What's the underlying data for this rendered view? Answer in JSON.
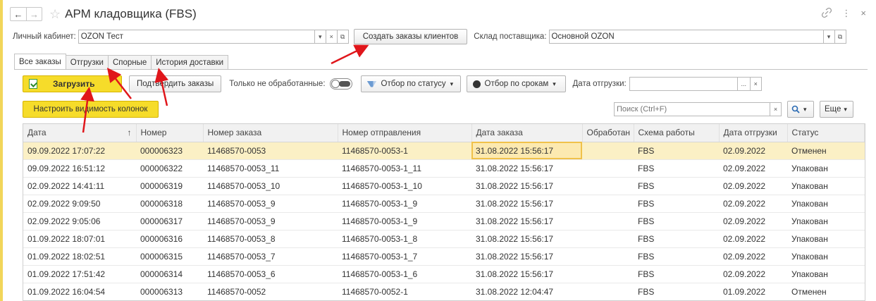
{
  "window": {
    "title": "АРМ кладовщика (FBS)",
    "back_icon": "←",
    "forward_icon": "→",
    "link_icon": "🔗",
    "menu_icon": "⋮",
    "close_icon": "×"
  },
  "header": {
    "cabinet_label": "Личный кабинет:",
    "cabinet_value": "OZON Тест",
    "create_orders_label": "Создать заказы клиентов",
    "warehouse_label": "Склад поставщика:",
    "warehouse_value": "Основной OZON"
  },
  "tabs": [
    {
      "label": "Все заказы",
      "active": true
    },
    {
      "label": "Отгрузки",
      "active": false
    },
    {
      "label": "Спорные",
      "active": false
    },
    {
      "label": "История доставки",
      "active": false
    }
  ],
  "toolbar": {
    "load_label": "Загрузить",
    "confirm_label": "Подтвердить заказы",
    "only_unprocessed_label": "Только не обработанные:",
    "status_filter_label": "Отбор по статусу",
    "term_filter_label": "Отбор по срокам",
    "ship_date_label": "Дата отгрузки:",
    "ship_date_value": "",
    "ellipsis": "...",
    "clear": "×",
    "columns_label": "Настроить видимость колонок",
    "search_placeholder": "Поиск (Ctrl+F)",
    "more_label": "Еще",
    "sort_arrow": "↑",
    "dropdown_arrow": "▾"
  },
  "table": {
    "columns": [
      "Дата",
      "Номер",
      "Номер заказа",
      "Номер отправления",
      "Дата заказа",
      "Обработан",
      "Схема работы",
      "Дата отгрузки",
      "Статус"
    ],
    "rows": [
      [
        "09.09.2022 17:07:22",
        "000006323",
        "11468570-0053",
        "11468570-0053-1",
        "31.08.2022 15:56:17",
        "",
        "FBS",
        "02.09.2022",
        "Отменен"
      ],
      [
        "09.09.2022 16:51:12",
        "000006322",
        "11468570-0053_11",
        "11468570-0053-1_11",
        "31.08.2022 15:56:17",
        "",
        "FBS",
        "02.09.2022",
        "Упакован"
      ],
      [
        "02.09.2022 14:41:11",
        "000006319",
        "11468570-0053_10",
        "11468570-0053-1_10",
        "31.08.2022 15:56:17",
        "",
        "FBS",
        "02.09.2022",
        "Упакован"
      ],
      [
        "02.09.2022 9:09:50",
        "000006318",
        "11468570-0053_9",
        "11468570-0053-1_9",
        "31.08.2022 15:56:17",
        "",
        "FBS",
        "02.09.2022",
        "Упакован"
      ],
      [
        "02.09.2022 9:05:06",
        "000006317",
        "11468570-0053_9",
        "11468570-0053-1_9",
        "31.08.2022 15:56:17",
        "",
        "FBS",
        "02.09.2022",
        "Упакован"
      ],
      [
        "01.09.2022 18:07:01",
        "000006316",
        "11468570-0053_8",
        "11468570-0053-1_8",
        "31.08.2022 15:56:17",
        "",
        "FBS",
        "02.09.2022",
        "Упакован"
      ],
      [
        "01.09.2022 18:02:51",
        "000006315",
        "11468570-0053_7",
        "11468570-0053-1_7",
        "31.08.2022 15:56:17",
        "",
        "FBS",
        "02.09.2022",
        "Упакован"
      ],
      [
        "01.09.2022 17:51:42",
        "000006314",
        "11468570-0053_6",
        "11468570-0053-1_6",
        "31.08.2022 15:56:17",
        "",
        "FBS",
        "02.09.2022",
        "Упакован"
      ],
      [
        "01.09.2022 16:04:54",
        "000006313",
        "11468570-0052",
        "11468570-0052-1",
        "31.08.2022 12:04:47",
        "",
        "FBS",
        "01.09.2022",
        "Отменен"
      ]
    ]
  },
  "colors": {
    "accent_yellow": "#f6dc2a",
    "selected_row": "#fbf0c5",
    "annotation_red": "#e0161b"
  }
}
